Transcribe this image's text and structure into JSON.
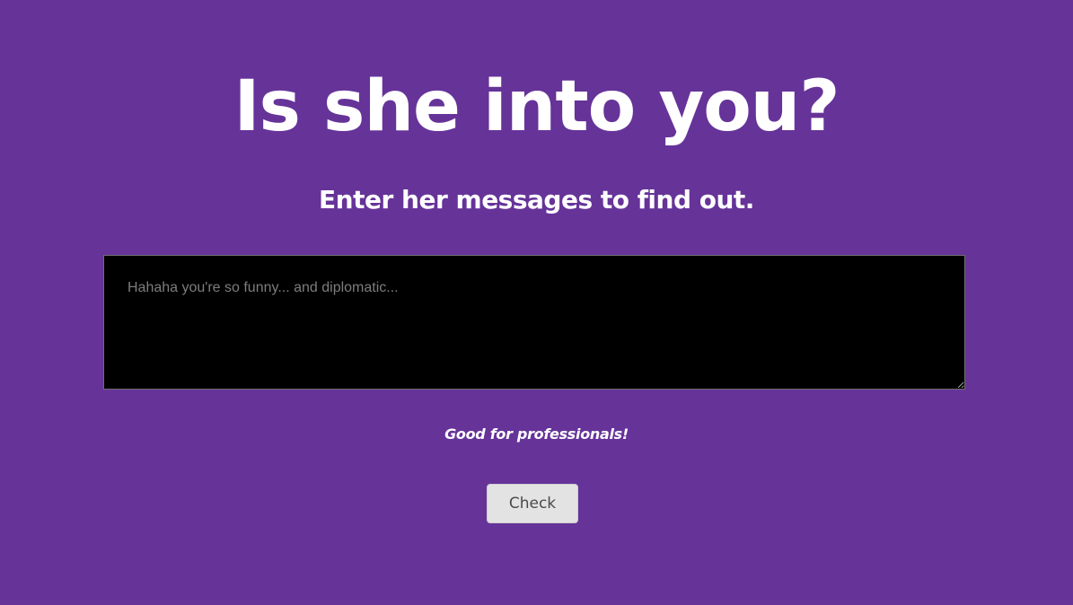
{
  "header": {
    "title": "Is she into you?",
    "subtitle": "Enter her messages to find out."
  },
  "form": {
    "message_placeholder": "Hahaha you're so funny... and diplomatic...",
    "message_value": "",
    "tagline": "Good for professionals!",
    "check_label": "Check"
  },
  "colors": {
    "background": "#663399",
    "input_background": "#000000",
    "button_background": "#e3e3e3"
  }
}
